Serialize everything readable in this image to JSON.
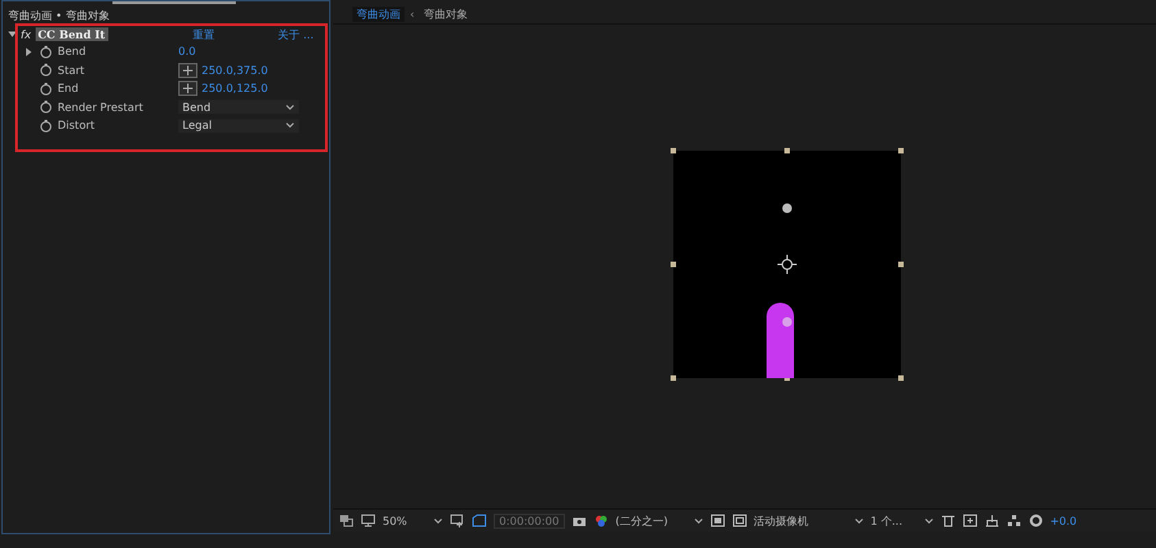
{
  "effect_controls": {
    "breadcrumb": "弯曲动画 • 弯曲对象",
    "effect": {
      "fx_label": "fx",
      "name": "CC Bend It",
      "expanded": true,
      "reset": "重置",
      "about": "关于 ..."
    },
    "params": [
      {
        "kind": "number",
        "name": "Bend",
        "expanded": false,
        "value": "0.0"
      },
      {
        "kind": "point",
        "name": "Start",
        "value": "250.0,375.0"
      },
      {
        "kind": "point",
        "name": "End",
        "value": "250.0,125.0"
      },
      {
        "kind": "dropdown",
        "name": "Render Prestart",
        "value": "Bend"
      },
      {
        "kind": "dropdown",
        "name": "Distort",
        "value": "Legal"
      }
    ]
  },
  "viewer": {
    "tab_separator": "‹",
    "tabs": [
      {
        "label": "弯曲动画",
        "selected": true
      },
      {
        "label": "弯曲对象",
        "selected": false
      }
    ],
    "toolbar": {
      "zoom": "50%",
      "timecode": "0:00:00:00",
      "resolution": "(二分之一)",
      "camera": "活动摄像机",
      "views": "1 个...",
      "exposure": "+0.0"
    }
  }
}
